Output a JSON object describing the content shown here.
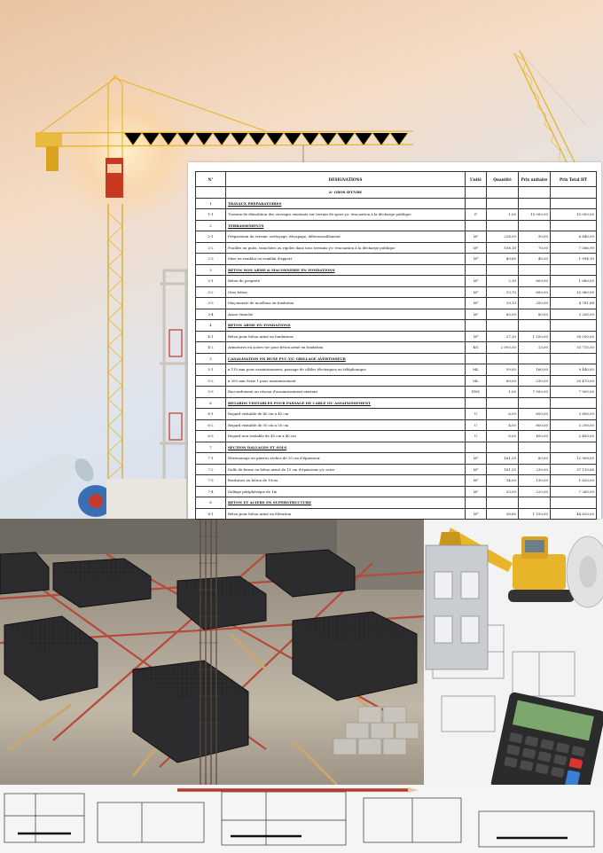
{
  "quote_table": {
    "headers": [
      "N°",
      "DESIGNATIONS",
      "Unité",
      "Quantité",
      "Prix unitaire",
      "Prix Total HT"
    ],
    "subtitle": "A-  GROS ŒUVRE",
    "rows": [
      {
        "kind": "section",
        "num": "1",
        "label": "TRAVAUX PREPARATOIRES"
      },
      {
        "kind": "item",
        "num": "1-1",
        "label": "Travaux de démolition des ouvrages existants sur terrain de sport y/c évacuation à la décharge publique",
        "unit": "F",
        "qty": "1,00",
        "pu": "15 000,00",
        "total": "15 000,00"
      },
      {
        "kind": "section",
        "num": "2",
        "label": "TERRASSEMENTS"
      },
      {
        "kind": "item",
        "num": "2-1",
        "label": "Préparation du terrain: nettoyage, décapage, débroussaillement",
        "unit": "M²",
        "qty": "228,00",
        "pu": "30,00",
        "total": "6 840,00"
      },
      {
        "kind": "item",
        "num": "2-2",
        "label": "Fouilles en puits, tranchées ou rigoles dans tous terrains y/c évacuation à la décharge publique",
        "unit": "M³",
        "qty": "108,18",
        "pu": "70,00",
        "total": "7 566,99"
      },
      {
        "kind": "item",
        "num": "2-3",
        "label": "Mise en remblai ou remblai d'apport",
        "unit": "M³",
        "qty": "49,85",
        "pu": "40,00",
        "total": "1 994,10"
      },
      {
        "kind": "section",
        "num": "3",
        "label": "BETON NON ARME & MACONNERIE EN FONDATIONS"
      },
      {
        "kind": "item",
        "num": "3-1",
        "label": "Béton de propreté",
        "unit": "M³",
        "qty": "2,10",
        "pu": "800,00",
        "total": "1 680,00"
      },
      {
        "kind": "item",
        "num": "3-2",
        "label": "Gros béton",
        "unit": "M³",
        "qty": "13,70",
        "pu": "800,00",
        "total": "10 960,00"
      },
      {
        "kind": "item",
        "num": "3-3",
        "label": "Maçonnerie de moellons en fondation",
        "unit": "M³",
        "qty": "19,13",
        "pu": "250,00",
        "total": "4 781,88"
      },
      {
        "kind": "item",
        "num": "3-4",
        "label": "Arase étanche",
        "unit": "M²",
        "qty": "65,00",
        "pu": "80,00",
        "total": "5 200,00"
      },
      {
        "kind": "section",
        "num": "4",
        "label": "BETON ARME EN FONDATIONS"
      },
      {
        "kind": "item",
        "num": "4-1",
        "label": "Béton pour béton armé en fondations",
        "unit": "M³",
        "qty": "27,30",
        "pu": "1 100,00",
        "total": "30 030,00"
      },
      {
        "kind": "item",
        "num": "4-2",
        "label": "Armatures en aciers tor pour béton armé en fondation",
        "unit": "KG",
        "qty": "2 593,50",
        "pu": "13,00",
        "total": "33 715,50"
      },
      {
        "kind": "section",
        "num": "5",
        "label": "CANALISATION EN BUSE PVC Y/C GRILLAGE AVERTISSEUR"
      },
      {
        "kind": "item",
        "num": "5-1",
        "label": "ø 110 mm pour assainissement, passage de câbles électriques ou téléphonique",
        "unit": "ML",
        "qty": "59,00",
        "pu": "160,00",
        "total": "9 440,00"
      },
      {
        "kind": "item",
        "num": "5-2",
        "label": "ø 200 mm Serie 1 pour assainissement",
        "unit": "ML",
        "qty": "89,00",
        "pu": "230,00",
        "total": "20 470,00"
      },
      {
        "kind": "item",
        "num": "5-3",
        "label": "Raccordement au réseau d'assainissement existant",
        "unit": "ENS",
        "qty": "1,00",
        "pu": "7 500,00",
        "total": "7 500,00"
      },
      {
        "kind": "section",
        "num": "6",
        "label": "REGARDS VISITABLES POUR PASSAGE DE CABLE OU ASSAINISSEMENT"
      },
      {
        "kind": "item",
        "num": "6-1",
        "label": "Regard visitable de 40 cm x 40 cm",
        "unit": "U",
        "qty": "6,00",
        "pu": "600,00",
        "total": "3 600,00"
      },
      {
        "kind": "item",
        "num": "6-2",
        "label": "Regard visitable de 50 cm x 50 cm",
        "unit": "U",
        "qty": "4,00",
        "pu": "800,00",
        "total": "3 200,00"
      },
      {
        "kind": "item",
        "num": "6-3",
        "label": "Regard non visitable de 40 cm x 40 cm",
        "unit": "U",
        "qty": "6,00",
        "pu": "400,00",
        "total": "2 400,00"
      },
      {
        "kind": "section",
        "num": "7",
        "label": "SECTION  DALLAGES ET SOLS"
      },
      {
        "kind": "item",
        "num": "7-1",
        "label": "Hérissonage en pierres sèches de 20 cm d'épaisseur",
        "unit": "M²",
        "qty": "161,35",
        "pu": "80,00",
        "total": "12 908,00"
      },
      {
        "kind": "item",
        "num": "7-2",
        "label": "Dalle de forme en béton armé de 15 cm d'épaisseur y/c acier",
        "unit": "M²",
        "qty": "161,35",
        "pu": "230,00",
        "total": "37 110,66"
      },
      {
        "kind": "item",
        "num": "7-3",
        "label": "Bordurois en béton de 10cm",
        "unit": "M²",
        "qty": "14,00",
        "pu": "130,00",
        "total": "1 820,00"
      },
      {
        "kind": "item",
        "num": "7-4",
        "label": "Dallage périphérique de 1m",
        "unit": "M²",
        "qty": "33,00",
        "pu": "220,00",
        "total": "7 260,00"
      },
      {
        "kind": "section",
        "num": "8",
        "label": "BETON ET ACIERS  EN SUPERSTRUCTURE"
      },
      {
        "kind": "item",
        "num": "8-1",
        "label": "Béton pour béton armé en élévation",
        "unit": "M³",
        "qty": "38,80",
        "pu": "1 150,00",
        "total": "44 620,00"
      }
    ]
  },
  "colors": {
    "crane_yellow": "#e8b52a",
    "sky_top": "#e9c3a0",
    "sky_bottom": "#cdd9e8",
    "rebar_red": "#b54a3a",
    "formwork_black": "#2c2c2e"
  },
  "illustrations": [
    "tower-crane",
    "rebar-foundation-site",
    "blueprints",
    "calculator",
    "excavator",
    "measuring-tape",
    "concrete-blocks"
  ]
}
